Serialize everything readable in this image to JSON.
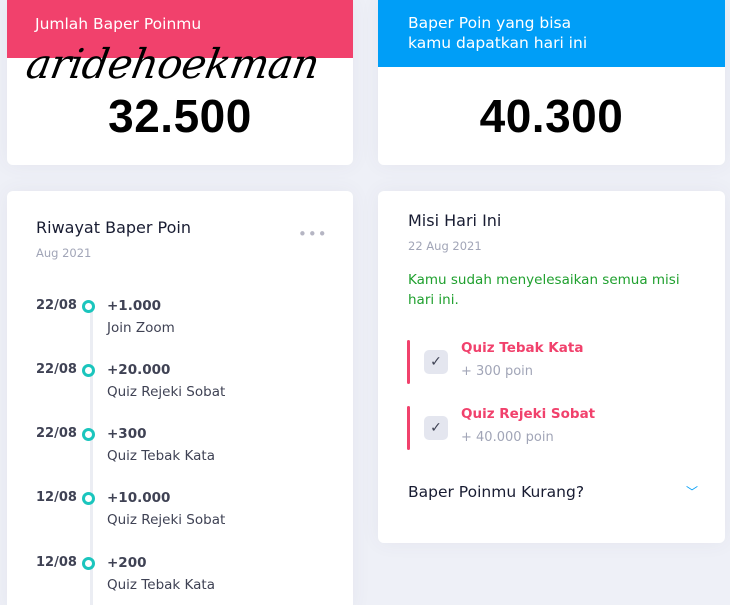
{
  "total_card": {
    "label": "Jumlah Baper Poinmu",
    "value": "32.500",
    "watermark": "aridehoekman"
  },
  "today_card": {
    "label_line1": "Baper Poin yang bisa",
    "label_line2": "kamu dapatkan hari ini",
    "value": "40.300"
  },
  "history": {
    "title": "Riwayat Baper Poin",
    "subtitle": "Aug 2021",
    "menu_icon": "•••",
    "items": [
      {
        "date": "22/08",
        "amount": "+1.000",
        "desc": "Join Zoom"
      },
      {
        "date": "22/08",
        "amount": "+20.000",
        "desc": "Quiz Rejeki Sobat"
      },
      {
        "date": "22/08",
        "amount": "+300",
        "desc": "Quiz Tebak Kata"
      },
      {
        "date": "12/08",
        "amount": "+10.000",
        "desc": "Quiz Rejeki Sobat"
      },
      {
        "date": "12/08",
        "amount": "+200",
        "desc": "Quiz Tebak Kata"
      }
    ]
  },
  "mission": {
    "title": "Misi Hari Ini",
    "subtitle": "22 Aug 2021",
    "message": "Kamu sudah menyelesaikan semua misi hari ini.",
    "items": [
      {
        "name": "Quiz Tebak Kata",
        "points": "+ 300 poin",
        "check": "✓"
      },
      {
        "name": "Quiz Rejeki Sobat",
        "points": "+ 40.000 poin",
        "check": "✓"
      }
    ],
    "more_label": "Baper Poinmu Kurang?",
    "more_icon": "﹀"
  },
  "colors": {
    "accent_red": "#f1416c",
    "accent_blue": "#009ef7",
    "success_green": "#1fa02e",
    "timeline_teal": "#1bc5bd"
  }
}
